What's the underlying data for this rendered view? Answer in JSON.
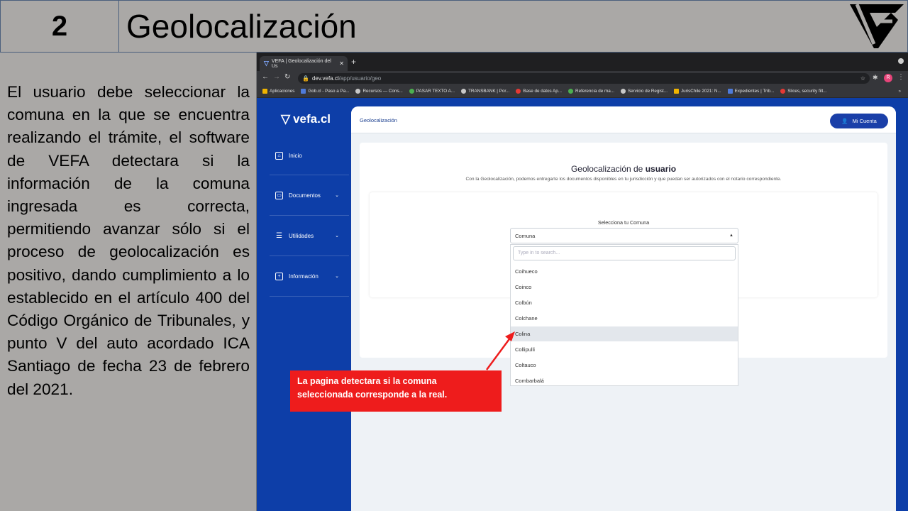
{
  "slide": {
    "number": "2",
    "title": "Geolocalización",
    "description": "El usuario debe seleccionar la comuna en la que se encuentra realizando el trámite, el software de VEFA detectara si la información de la comuna ingresada es correcta, permitiendo avanzar sólo si el proceso de geolocalización es positivo, dando cumplimiento a lo establecido en el artículo 400 del Código Orgánico de Tribunales, y punto V del auto acordado ICA Santiago de fecha 23 de febrero del 2021.",
    "callout": "La pagina detectara si la comuna seleccionada corresponde a la real."
  },
  "browser": {
    "tab_title": "VEFA | Geolocalización del Us",
    "new_tab": "+",
    "url_host": "dev.vefa.cl",
    "url_path": "/app/usuario/geo",
    "profile_initial": "R",
    "bookmarks": [
      {
        "label": "Aplicaciones",
        "icon": "apps-icon"
      },
      {
        "label": "Gob.cl - Paso a Pa...",
        "icon": "gob-icon"
      },
      {
        "label": "Recursos — Cons...",
        "icon": "globe-icon"
      },
      {
        "label": "PASAR TEXTO A...",
        "icon": "chrome-icon"
      },
      {
        "label": "TRANSBANK | Por...",
        "icon": "globe-icon"
      },
      {
        "label": "Base de datos Ap...",
        "icon": "youtube-icon"
      },
      {
        "label": "Referencia de ma...",
        "icon": "chrome-icon"
      },
      {
        "label": "Servicio de Regist...",
        "icon": "globe-icon"
      },
      {
        "label": "JurisChile 2021: N...",
        "icon": "doc-icon"
      },
      {
        "label": "Expedientes | Trib...",
        "icon": "cloud-icon"
      },
      {
        "label": "Slices, security filt...",
        "icon": "youtube-icon"
      }
    ],
    "bookmarks_more": "»"
  },
  "app": {
    "brand": "vefa.cl",
    "nav": [
      {
        "label": "Inicio",
        "icon": "home-icon",
        "has_chevron": false
      },
      {
        "label": "Documentos",
        "icon": "archive-icon",
        "has_chevron": true
      },
      {
        "label": "Utilidades",
        "icon": "list-icon",
        "has_chevron": true
      },
      {
        "label": "Información",
        "icon": "plus-square-icon",
        "has_chevron": true
      }
    ],
    "breadcrumb": "Geolocalización",
    "account_button": "Mi Cuenta",
    "card_title_prefix": "Geolocalización de ",
    "card_title_bold": "usuario",
    "card_subtitle": "Con la Geolocalización, podemos entregarte los documentos disponibles en tu jurisdicción y que puedan ser autorizados con el notario correspondiente.",
    "select_label": "Selecciona tu Comuna",
    "select_value": "Comuna",
    "search_placeholder": "Type in to search...",
    "options": [
      "Coihueco",
      "Coinco",
      "Colbún",
      "Colchane",
      "Colina",
      "Collipulli",
      "Coltauco",
      "Combarbalá"
    ],
    "highlighted_option": "Colina"
  },
  "colors": {
    "slide_bg": "#aaa8a6",
    "app_blue": "#0d3ea8",
    "callout_red": "#ee1c1c"
  }
}
